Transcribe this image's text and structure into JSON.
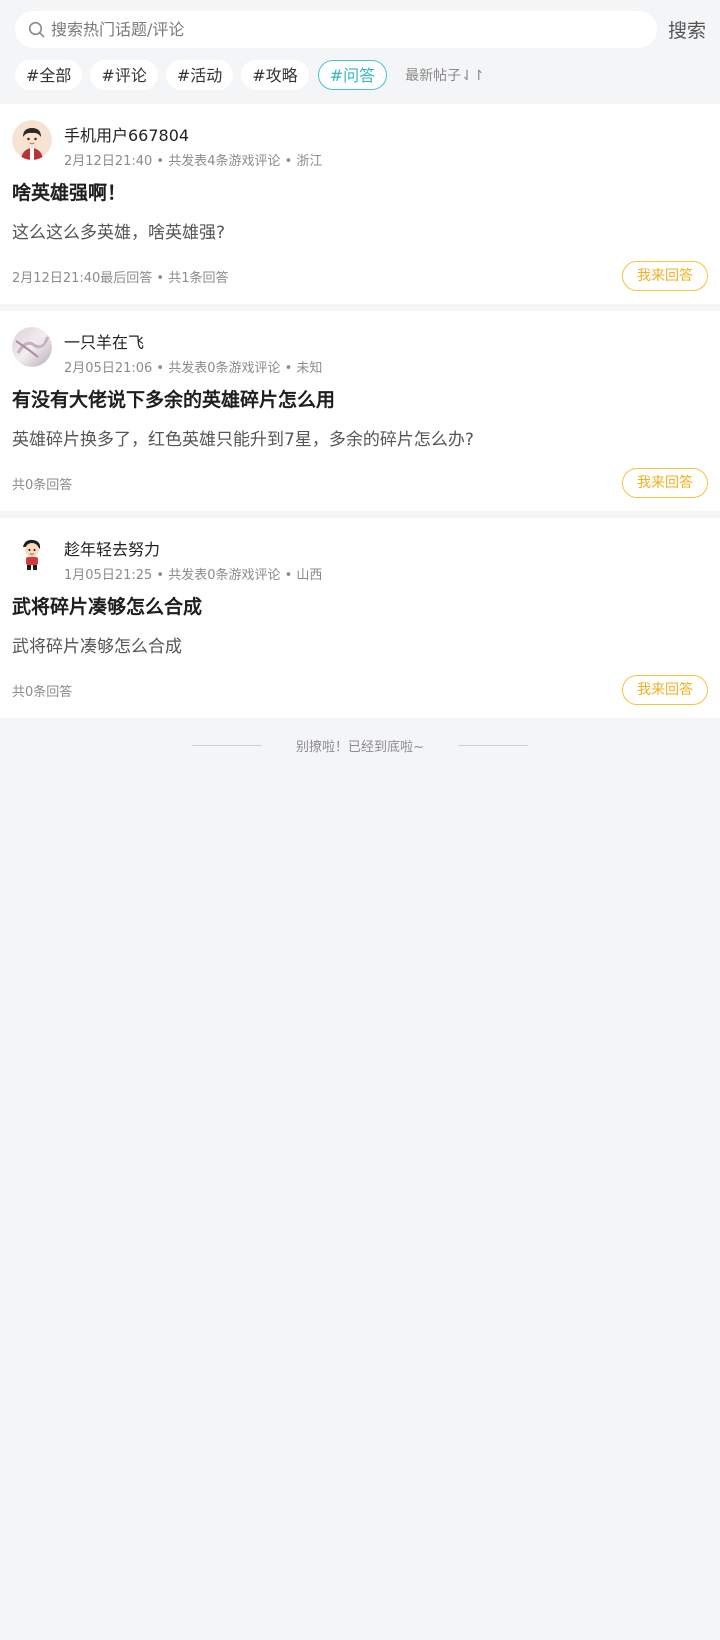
{
  "search": {
    "placeholder": "搜索热门话题/评论",
    "button_label": "搜索"
  },
  "tags": [
    {
      "label": "#全部",
      "active": false
    },
    {
      "label": "#评论",
      "active": false
    },
    {
      "label": "#活动",
      "active": false
    },
    {
      "label": "#攻略",
      "active": false
    },
    {
      "label": "#问答",
      "active": true
    }
  ],
  "sort_label": "最新帖子⇃↾",
  "posts": [
    {
      "username": "手机用户667804",
      "meta": "2月12日21:40 • 共发表4条游戏评论 • 浙江",
      "title": "啥英雄强啊！",
      "content": "这么这么多英雄，啥英雄强?",
      "footer": "2月12日21:40最后回答 • 共1条回答",
      "answer_label": "我来回答",
      "avatar_icon": "cartoon-boy-avatar"
    },
    {
      "username": "一只羊在飞",
      "meta": "2月05日21:06 • 共发表0条游戏评论 • 未知",
      "title": "有没有大佬说下多余的英雄碎片怎么用",
      "content": "英雄碎片换多了，红色英雄只能升到7星，多余的碎片怎么办?",
      "footer": "共0条回答",
      "answer_label": "我来回答",
      "avatar_icon": "photo-avatar"
    },
    {
      "username": "趁年轻去努力",
      "meta": "1月05日21:25 • 共发表0条游戏评论 • 山西",
      "title": "武将碎片凑够怎么合成",
      "content": "武将碎片凑够怎么合成",
      "footer": "共0条回答",
      "answer_label": "我来回答",
      "avatar_icon": "cartoon-character-avatar"
    }
  ],
  "end_note": "别撩啦！已经到底啦~",
  "colors": {
    "accent": "#33b6c4",
    "answer": "#f0b020",
    "background": "#f4f5f7"
  }
}
